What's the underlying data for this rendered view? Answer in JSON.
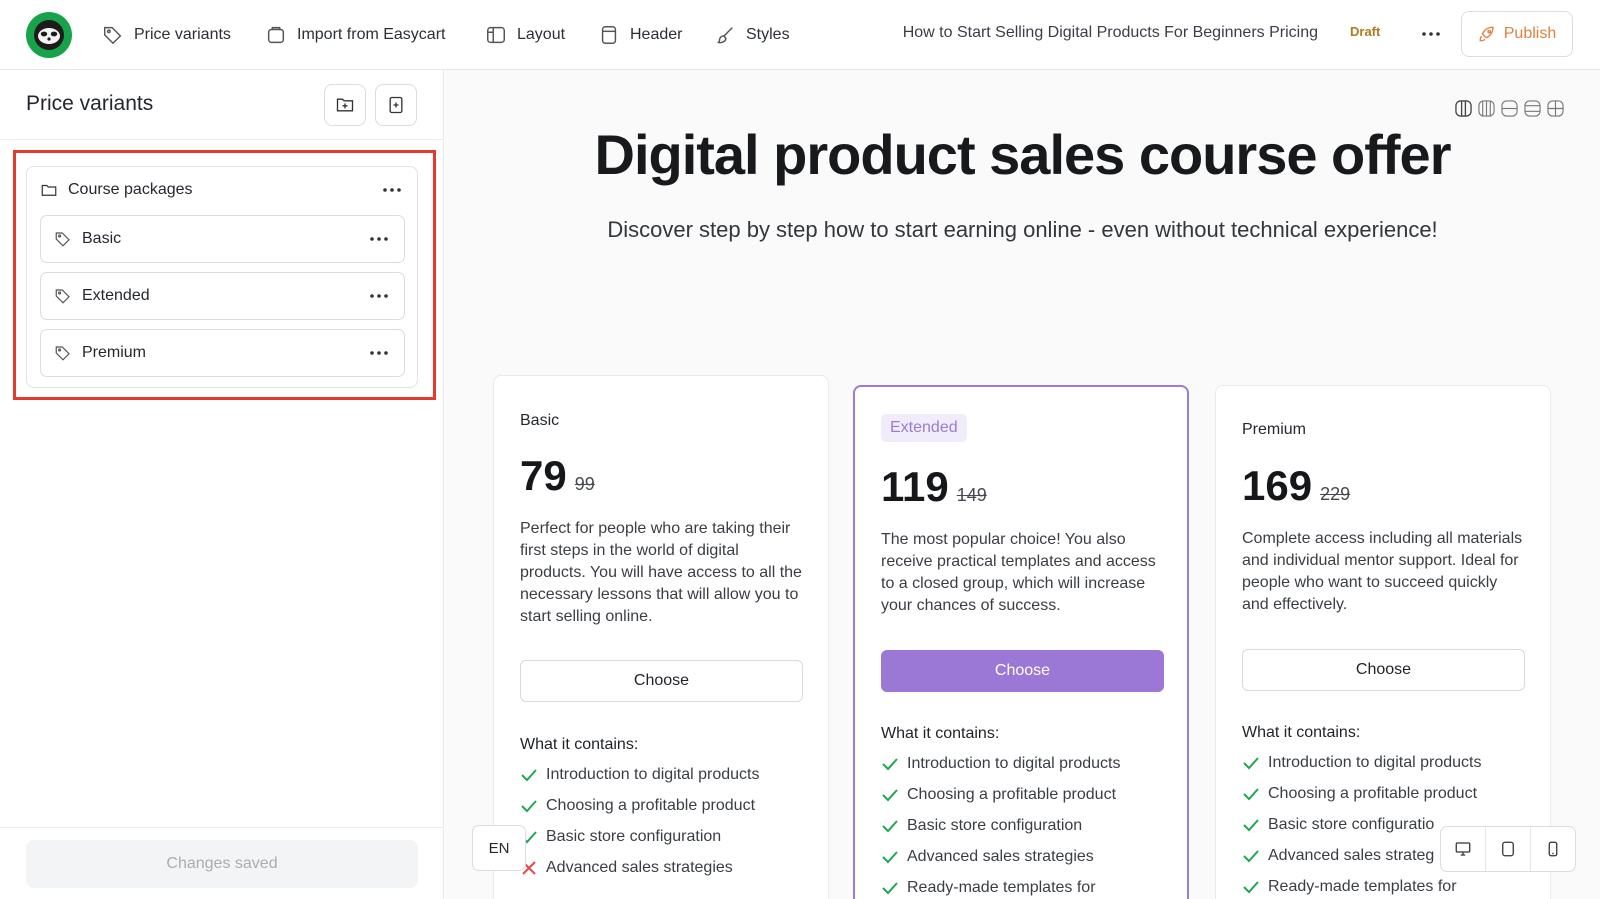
{
  "topbar": {
    "nav": [
      {
        "label": "Price variants",
        "icon": "tag-icon"
      },
      {
        "label": "Import from Easycart",
        "icon": "import-icon"
      },
      {
        "label": "Layout",
        "icon": "layout-icon"
      },
      {
        "label": "Header",
        "icon": "header-icon"
      },
      {
        "label": "Styles",
        "icon": "brush-icon"
      }
    ],
    "doc_title": "How to Start Selling Digital Products For Beginners Pricing",
    "status": "Draft",
    "publish_label": "Publish"
  },
  "sidebar": {
    "title": "Price variants",
    "folder": {
      "label": "Course packages"
    },
    "items": [
      {
        "label": "Basic"
      },
      {
        "label": "Extended"
      },
      {
        "label": "Premium"
      }
    ],
    "footer_status": "Changes saved"
  },
  "page": {
    "headline": "Digital product sales course offer",
    "subheadline": "Discover step by step how to start earning online - even without technical experience!",
    "plans": [
      {
        "name": "Basic",
        "price": "79",
        "old_price": "99",
        "description": "Perfect for people who are taking their first steps in the world of digital products. You will have access to all the necessary lessons that will allow you to start selling online.",
        "cta": "Choose",
        "contains_label": "What it contains:",
        "features": [
          {
            "text": "Introduction to digital products",
            "included": true
          },
          {
            "text": "Choosing a profitable product",
            "included": true
          },
          {
            "text": "Basic store configuration",
            "included": true
          },
          {
            "text": "Advanced sales strategies",
            "included": false
          }
        ]
      },
      {
        "name": "Extended",
        "price": "119",
        "old_price": "149",
        "description": "The most popular choice! You also receive practical templates and access to a closed group, which will increase your chances of success.",
        "cta": "Choose",
        "contains_label": "What it contains:",
        "features": [
          {
            "text": "Introduction to digital products",
            "included": true
          },
          {
            "text": "Choosing a profitable product",
            "included": true
          },
          {
            "text": "Basic store configuration",
            "included": true
          },
          {
            "text": "Advanced sales strategies",
            "included": true
          },
          {
            "text": "Ready-made templates for",
            "included": true
          }
        ]
      },
      {
        "name": "Premium",
        "price": "169",
        "old_price": "229",
        "description": "Complete access including all materials and individual mentor support. Ideal for people who want to succeed quickly and effectively.",
        "cta": "Choose",
        "contains_label": "What it contains:",
        "features": [
          {
            "text": "Introduction to digital products",
            "included": true
          },
          {
            "text": "Choosing a profitable product",
            "included": true
          },
          {
            "text": "Basic store configuratio",
            "included": true
          },
          {
            "text": "Advanced sales strateg",
            "included": true
          },
          {
            "text": "Ready-made templates for",
            "included": true
          }
        ]
      }
    ]
  },
  "language": "EN",
  "colors": {
    "accent": "#9b78d6",
    "publish": "#e0803e",
    "highlight": "#e53a2b",
    "check": "#22a652",
    "cross": "#e5484d"
  }
}
